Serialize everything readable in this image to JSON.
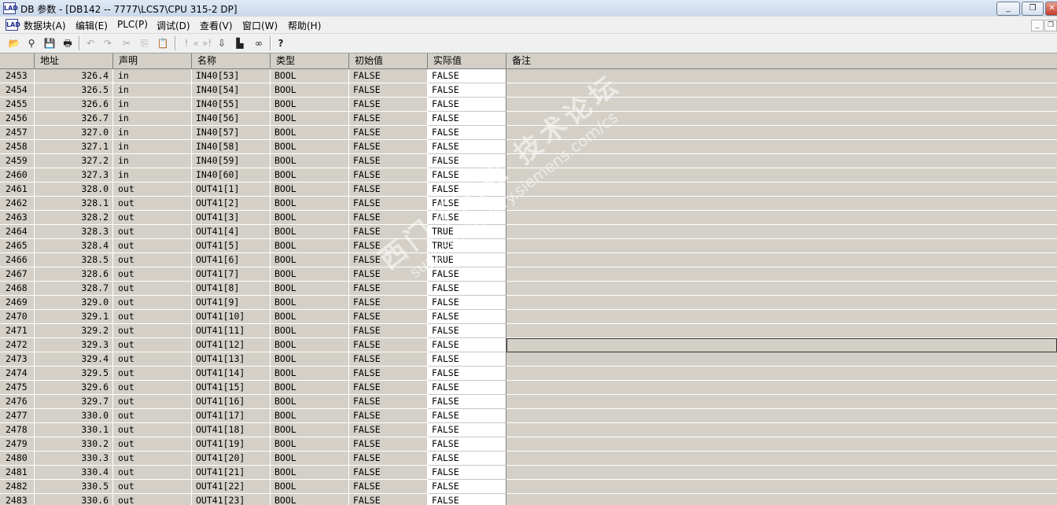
{
  "window": {
    "title": "DB 参数 - [DB142 -- 7777\\LCS7\\CPU 315-2 DP]",
    "app_icon": "LAD",
    "buttons": {
      "minimize": "_",
      "restore": "❐",
      "close": "✕"
    }
  },
  "menu": {
    "doc_icon": "LAD",
    "items": [
      "数据块(A)",
      "编辑(E)",
      "PLC(P)",
      "调试(D)",
      "查看(V)",
      "窗口(W)",
      "帮助(H)"
    ],
    "mdi_minimize": "_",
    "mdi_restore": "❐"
  },
  "toolbar": {
    "icons": [
      "open-icon",
      "network-icon",
      "save-icon",
      "print-icon",
      "undo-icon",
      "redo-icon",
      "cut-icon",
      "copy-icon",
      "paste-icon",
      "breakpoint-icon",
      "step-back-icon",
      "step-forward-icon",
      "load-icon",
      "monitor-icon",
      "glasses-icon",
      "help-icon"
    ]
  },
  "table": {
    "headers": {
      "address": "地址",
      "declaration": "声明",
      "name": "名称",
      "type": "类型",
      "initial": "初始值",
      "actual": "实际值",
      "comment": "备注"
    },
    "rows": [
      {
        "n": "2453",
        "addr": "326.4",
        "decl": "in",
        "name": "IN40[53]",
        "type": "BOOL",
        "init": "FALSE",
        "act": "FALSE"
      },
      {
        "n": "2454",
        "addr": "326.5",
        "decl": "in",
        "name": "IN40[54]",
        "type": "BOOL",
        "init": "FALSE",
        "act": "FALSE"
      },
      {
        "n": "2455",
        "addr": "326.6",
        "decl": "in",
        "name": "IN40[55]",
        "type": "BOOL",
        "init": "FALSE",
        "act": "FALSE"
      },
      {
        "n": "2456",
        "addr": "326.7",
        "decl": "in",
        "name": "IN40[56]",
        "type": "BOOL",
        "init": "FALSE",
        "act": "FALSE"
      },
      {
        "n": "2457",
        "addr": "327.0",
        "decl": "in",
        "name": "IN40[57]",
        "type": "BOOL",
        "init": "FALSE",
        "act": "FALSE"
      },
      {
        "n": "2458",
        "addr": "327.1",
        "decl": "in",
        "name": "IN40[58]",
        "type": "BOOL",
        "init": "FALSE",
        "act": "FALSE"
      },
      {
        "n": "2459",
        "addr": "327.2",
        "decl": "in",
        "name": "IN40[59]",
        "type": "BOOL",
        "init": "FALSE",
        "act": "FALSE"
      },
      {
        "n": "2460",
        "addr": "327.3",
        "decl": "in",
        "name": "IN40[60]",
        "type": "BOOL",
        "init": "FALSE",
        "act": "FALSE"
      },
      {
        "n": "2461",
        "addr": "328.0",
        "decl": "out",
        "name": "OUT41[1]",
        "type": "BOOL",
        "init": "FALSE",
        "act": "FALSE"
      },
      {
        "n": "2462",
        "addr": "328.1",
        "decl": "out",
        "name": "OUT41[2]",
        "type": "BOOL",
        "init": "FALSE",
        "act": "FALSE"
      },
      {
        "n": "2463",
        "addr": "328.2",
        "decl": "out",
        "name": "OUT41[3]",
        "type": "BOOL",
        "init": "FALSE",
        "act": "FALSE"
      },
      {
        "n": "2464",
        "addr": "328.3",
        "decl": "out",
        "name": "OUT41[4]",
        "type": "BOOL",
        "init": "FALSE",
        "act": "TRUE"
      },
      {
        "n": "2465",
        "addr": "328.4",
        "decl": "out",
        "name": "OUT41[5]",
        "type": "BOOL",
        "init": "FALSE",
        "act": "TRUE"
      },
      {
        "n": "2466",
        "addr": "328.5",
        "decl": "out",
        "name": "OUT41[6]",
        "type": "BOOL",
        "init": "FALSE",
        "act": "TRUE"
      },
      {
        "n": "2467",
        "addr": "328.6",
        "decl": "out",
        "name": "OUT41[7]",
        "type": "BOOL",
        "init": "FALSE",
        "act": "FALSE"
      },
      {
        "n": "2468",
        "addr": "328.7",
        "decl": "out",
        "name": "OUT41[8]",
        "type": "BOOL",
        "init": "FALSE",
        "act": "FALSE"
      },
      {
        "n": "2469",
        "addr": "329.0",
        "decl": "out",
        "name": "OUT41[9]",
        "type": "BOOL",
        "init": "FALSE",
        "act": "FALSE"
      },
      {
        "n": "2470",
        "addr": "329.1",
        "decl": "out",
        "name": "OUT41[10]",
        "type": "BOOL",
        "init": "FALSE",
        "act": "FALSE"
      },
      {
        "n": "2471",
        "addr": "329.2",
        "decl": "out",
        "name": "OUT41[11]",
        "type": "BOOL",
        "init": "FALSE",
        "act": "FALSE"
      },
      {
        "n": "2472",
        "addr": "329.3",
        "decl": "out",
        "name": "OUT41[12]",
        "type": "BOOL",
        "init": "FALSE",
        "act": "FALSE",
        "selected": true
      },
      {
        "n": "2473",
        "addr": "329.4",
        "decl": "out",
        "name": "OUT41[13]",
        "type": "BOOL",
        "init": "FALSE",
        "act": "FALSE"
      },
      {
        "n": "2474",
        "addr": "329.5",
        "decl": "out",
        "name": "OUT41[14]",
        "type": "BOOL",
        "init": "FALSE",
        "act": "FALSE"
      },
      {
        "n": "2475",
        "addr": "329.6",
        "decl": "out",
        "name": "OUT41[15]",
        "type": "BOOL",
        "init": "FALSE",
        "act": "FALSE"
      },
      {
        "n": "2476",
        "addr": "329.7",
        "decl": "out",
        "name": "OUT41[16]",
        "type": "BOOL",
        "init": "FALSE",
        "act": "FALSE"
      },
      {
        "n": "2477",
        "addr": "330.0",
        "decl": "out",
        "name": "OUT41[17]",
        "type": "BOOL",
        "init": "FALSE",
        "act": "FALSE"
      },
      {
        "n": "2478",
        "addr": "330.1",
        "decl": "out",
        "name": "OUT41[18]",
        "type": "BOOL",
        "init": "FALSE",
        "act": "FALSE"
      },
      {
        "n": "2479",
        "addr": "330.2",
        "decl": "out",
        "name": "OUT41[19]",
        "type": "BOOL",
        "init": "FALSE",
        "act": "FALSE"
      },
      {
        "n": "2480",
        "addr": "330.3",
        "decl": "out",
        "name": "OUT41[20]",
        "type": "BOOL",
        "init": "FALSE",
        "act": "FALSE"
      },
      {
        "n": "2481",
        "addr": "330.4",
        "decl": "out",
        "name": "OUT41[21]",
        "type": "BOOL",
        "init": "FALSE",
        "act": "FALSE"
      },
      {
        "n": "2482",
        "addr": "330.5",
        "decl": "out",
        "name": "OUT41[22]",
        "type": "BOOL",
        "init": "FALSE",
        "act": "FALSE"
      },
      {
        "n": "2483",
        "addr": "330.6",
        "decl": "out",
        "name": "OUT41[23]",
        "type": "BOOL",
        "init": "FALSE",
        "act": "FALSE"
      }
    ]
  },
  "watermark": {
    "text": "西门子工业 技术论坛",
    "url": "support.industry.siemens.com/cs"
  }
}
